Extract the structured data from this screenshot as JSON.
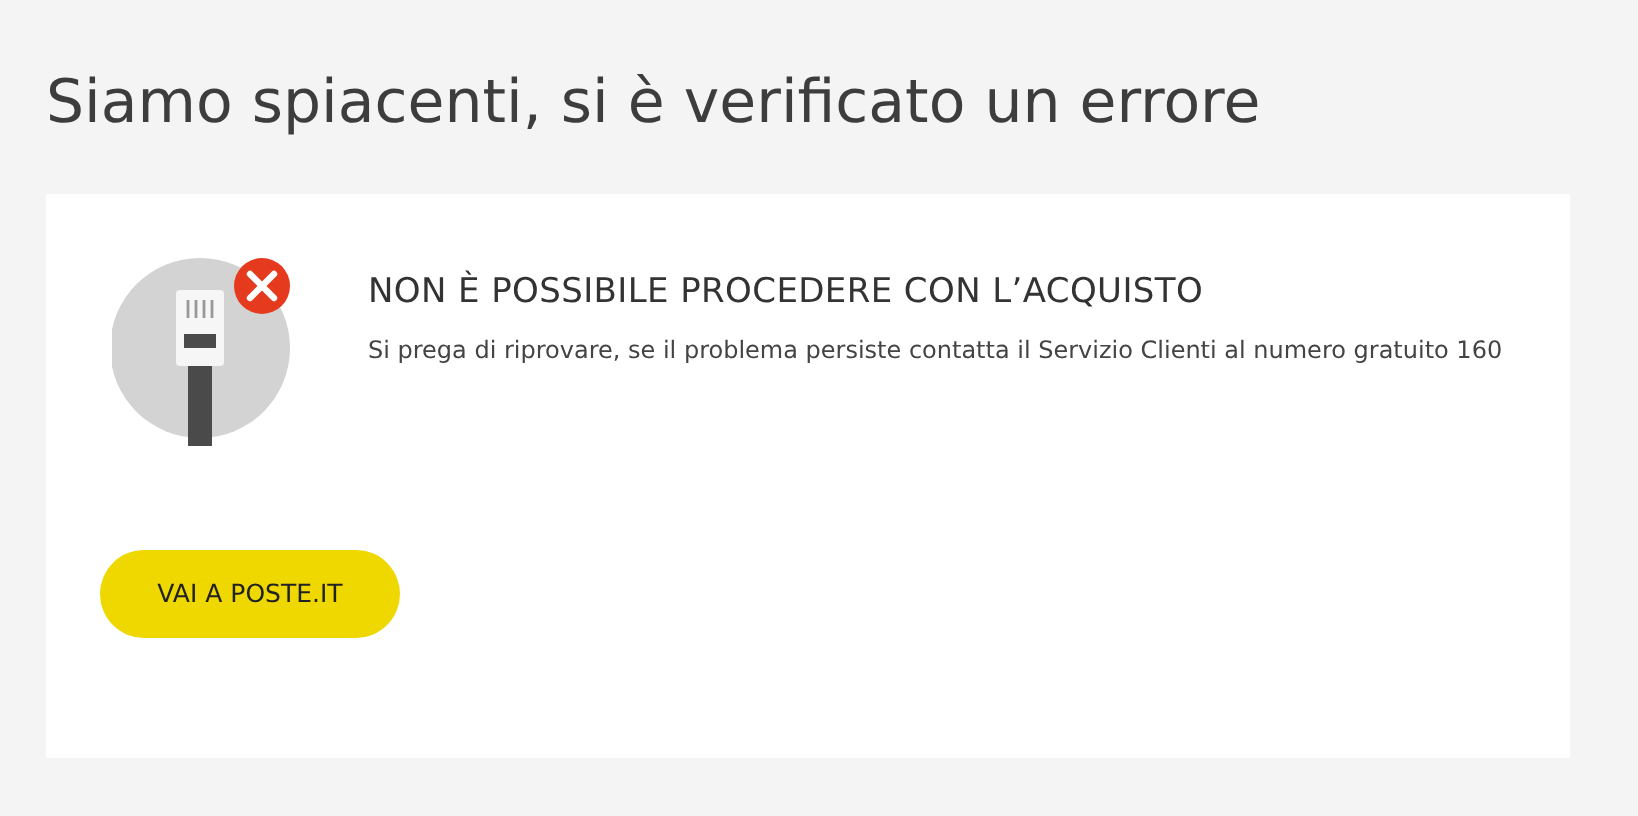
{
  "page": {
    "title": "Siamo spiacenti, si è verificato un errore"
  },
  "error_card": {
    "heading": "NON È POSSIBILE PROCEDERE CON L’ACQUISTO",
    "message": "Si prega di riprovare, se il problema persiste contatta il Servizio Clienti al numero gratuito 160",
    "button": "VAI A POSTE.IT"
  }
}
